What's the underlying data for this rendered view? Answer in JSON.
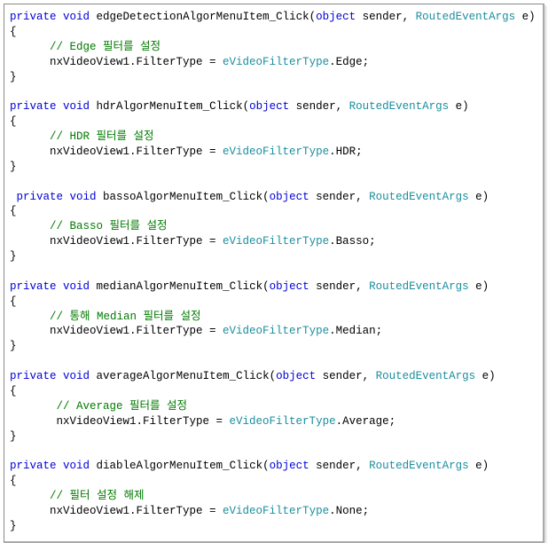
{
  "colors": {
    "keyword": "#0000d8",
    "type": "#1b8e9e",
    "comment": "#007a00",
    "text": "#000000",
    "border": "#888888",
    "background": "#ffffff"
  },
  "code": {
    "methods": [
      {
        "signature": {
          "prefix_kw_private": "private",
          "prefix_kw_void": "void",
          "name": "edgeDetectionAlgorMenuItem_Click",
          "params_open": "(",
          "param1_kw": "object",
          "param1_name": " sender, ",
          "param2_type": "RoutedEventArgs",
          "param2_name": " e)"
        },
        "open_brace": "{",
        "comment": "      // Edge 필터를 설정",
        "body_prefix": "      nxVideoView1.FilterType = ",
        "body_type": "eVideoFilterType",
        "body_suffix": ".Edge;",
        "close_brace": "}"
      },
      {
        "signature": {
          "prefix_kw_private": "private",
          "prefix_kw_void": "void",
          "name": "hdrAlgorMenuItem_Click",
          "params_open": "(",
          "param1_kw": "object",
          "param1_name": " sender, ",
          "param2_type": "RoutedEventArgs",
          "param2_name": " e)"
        },
        "open_brace": "{",
        "comment": "      // HDR 필터를 설정",
        "body_prefix": "      nxVideoView1.FilterType = ",
        "body_type": "eVideoFilterType",
        "body_suffix": ".HDR;",
        "close_brace": "}"
      },
      {
        "signature": {
          "prefix_kw_private": " private",
          "prefix_kw_void": "void",
          "name": "bassoAlgorMenuItem_Click",
          "params_open": "(",
          "param1_kw": "object",
          "param1_name": " sender, ",
          "param2_type": "RoutedEventArgs",
          "param2_name": " e)"
        },
        "open_brace": "{",
        "comment": "      // Basso 필터를 설정",
        "body_prefix": "      nxVideoView1.FilterType = ",
        "body_type": "eVideoFilterType",
        "body_suffix": ".Basso;",
        "close_brace": "}"
      },
      {
        "signature": {
          "prefix_kw_private": "private",
          "prefix_kw_void": "void",
          "name": "medianAlgorMenuItem_Click",
          "params_open": "(",
          "param1_kw": "object",
          "param1_name": " sender, ",
          "param2_type": "RoutedEventArgs",
          "param2_name": " e)"
        },
        "open_brace": "{",
        "comment": "      // 통해 Median 필터를 설정",
        "body_prefix": "      nxVideoView1.FilterType = ",
        "body_type": "eVideoFilterType",
        "body_suffix": ".Median;",
        "close_brace": "}"
      },
      {
        "signature": {
          "prefix_kw_private": "private",
          "prefix_kw_void": "void",
          "name": "averageAlgorMenuItem_Click",
          "params_open": "(",
          "param1_kw": "object",
          "param1_name": " sender, ",
          "param2_type": "RoutedEventArgs",
          "param2_name": " e)"
        },
        "open_brace": "{",
        "comment": "       // Average 필터를 설정",
        "body_prefix": "       nxVideoView1.FilterType = ",
        "body_type": "eVideoFilterType",
        "body_suffix": ".Average;",
        "close_brace": "}"
      },
      {
        "signature": {
          "prefix_kw_private": "private",
          "prefix_kw_void": "void",
          "name": "diableAlgorMenuItem_Click",
          "params_open": "(",
          "param1_kw": "object",
          "param1_name": " sender, ",
          "param2_type": "RoutedEventArgs",
          "param2_name": " e)"
        },
        "open_brace": "{",
        "comment": "      // 필터 설정 해제",
        "body_prefix": "      nxVideoView1.FilterType = ",
        "body_type": "eVideoFilterType",
        "body_suffix": ".None;",
        "close_brace": "}"
      }
    ]
  }
}
